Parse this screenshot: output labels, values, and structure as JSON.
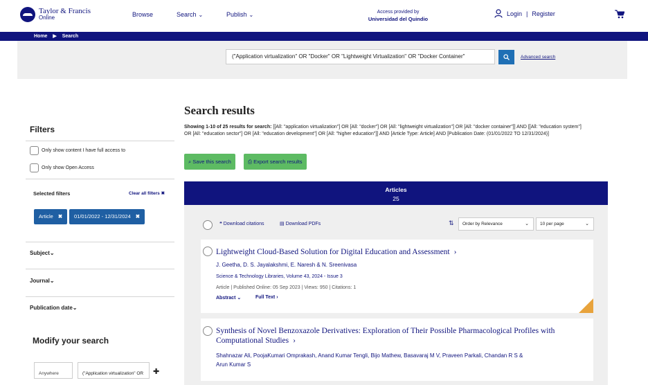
{
  "header": {
    "logo_line1": "Taylor & Francis",
    "logo_line2": "Online",
    "nav": [
      "Browse",
      "Search",
      "Publish"
    ],
    "access_label": "Access provided by",
    "access_org": "Universidad del Quindio",
    "login": "Login",
    "separator": "|",
    "register": "Register"
  },
  "breadcrumb": {
    "home": "Home",
    "arrow": "▶",
    "current": "Search"
  },
  "search": {
    "query": "(\"Application virtualization\" OR \"Docker\" OR \"Lightweight Virtualization\" OR \"Docker Container\"",
    "advanced": "Advanced search"
  },
  "filters": {
    "title": "Filters",
    "full_access": "Only show content I have full access to",
    "open_access": "Only show Open Access",
    "selected_title": "Selected filters",
    "clear_all": "Clear all filters",
    "chips": [
      "Article",
      "01/01/2022 - 12/31/2024"
    ],
    "facets": [
      "Subject",
      "Journal",
      "Publication date"
    ],
    "modify_title": "Modify your search",
    "modify_select": "Anywhere",
    "modify_input": "(\"Application virtualization\" OR"
  },
  "results": {
    "title": "Search results",
    "showing_bold": "Showing 1-10 of 25 results for search:",
    "showing_text": "[[All: \"application virtualization\"] OR [All: \"docker\"] OR [All: \"lightweight virtualization\"] OR [All: \"docker container\"]] AND [[All: \"education system\"] OR [All: \"education sector\"] OR [All: \"education development\"] OR [All: \"higher education\"]] AND [Article Type: Article] AND [Publication Date: (01/01/2022 TO 12/31/2024)]",
    "save_btn": "Save this search",
    "export_btn": "Export search results",
    "tab_label": "Articles",
    "tab_count": "25",
    "download_citations": "Download citations",
    "download_pdfs": "Download PDFs",
    "sort_value": "Order by Relevance",
    "per_page_value": "10 per page",
    "items": [
      {
        "title": "Lightweight Cloud-Based Solution for Digital Education and Assessment",
        "authors": "J. Geetha, D. S. Jayalakshmi, E. Naresh & N. Sreenivasa",
        "journal": "Science & Technology Libraries, Volume 43, 2024 - Issue 3",
        "meta": "Article | Published Online: 05 Sep 2023 | Views: 950 | Citations: 1",
        "abstract": "Abstract",
        "fulltext": "Full Text"
      },
      {
        "title_line1": "Synthesis of Novel Benzoxazole Derivatives: Exploration of Their Possible Pharmacological Profiles with",
        "title_line2": "Computational Studies",
        "authors_line1": "Shahnazar Ali, PoojaKumari Omprakash, Anand Kumar Tengli, Bijo Mathew, Basavaraj M V, Praveen Parkali, Chandan R S &",
        "authors_line2": "Arun Kumar S"
      }
    ]
  },
  "colors": {
    "brand": "#10147e",
    "green": "#5dbb63",
    "chip": "#1f5fa3",
    "open_access": "#e8a33c"
  }
}
